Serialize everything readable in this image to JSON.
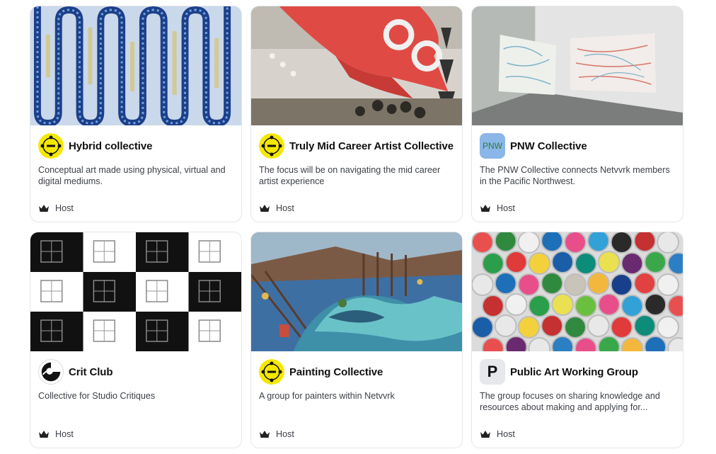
{
  "cards": [
    {
      "title": "Hybrid collective",
      "description": "Conceptual art made using physical, virtual and digital mediums.",
      "role": "Host",
      "avatar_icon": "yellow-emblem-icon"
    },
    {
      "title": "Truly Mid Career Artist Collective",
      "description": "The focus will be on navigating the mid career artist experience",
      "role": "Host",
      "avatar_icon": "yellow-emblem-icon"
    },
    {
      "title": "PNW Collective",
      "description": "The PNW Collective connects Netvvrk members in the Pacific Northwest.",
      "role": "Host",
      "avatar_text": "PNW"
    },
    {
      "title": "Crit Club",
      "description": "Collective for Studio Critiques",
      "role": "Host",
      "avatar_icon": "crit-club-logo-icon"
    },
    {
      "title": "Painting Collective",
      "description": "A group for painters within Netvvrk",
      "role": "Host",
      "avatar_icon": "yellow-emblem-icon"
    },
    {
      "title": "Public Art Working Group",
      "description": "The group focuses on sharing knowledge and resources about making and applying for...",
      "role": "Host",
      "avatar_text": "P"
    }
  ],
  "colors": {
    "accent_yellow": "#f5e800",
    "pnw_bg": "#8ab6e8",
    "pnw_text": "#2e7d32",
    "border": "#e4e6ea"
  }
}
